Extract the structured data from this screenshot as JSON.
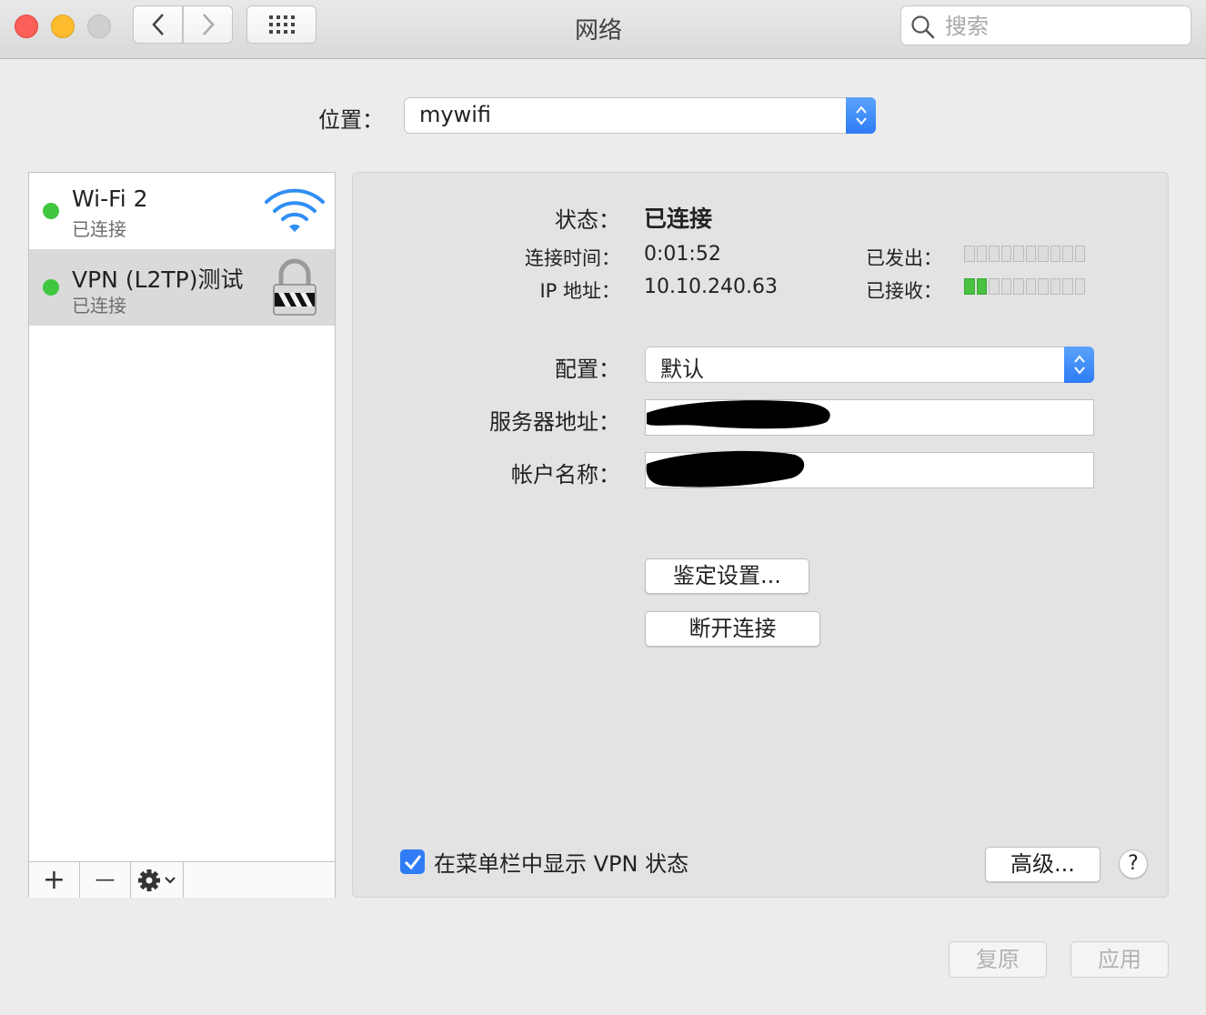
{
  "window": {
    "title": "网络"
  },
  "search": {
    "placeholder": "搜索"
  },
  "location": {
    "label": "位置：",
    "value": "mywifi"
  },
  "services": [
    {
      "name": "Wi-Fi 2",
      "status": "已连接",
      "icon": "wifi-icon",
      "status_color": "#3fc740"
    },
    {
      "name": "VPN (L2TP)测试",
      "status": "已连接",
      "icon": "vpn-lock-icon",
      "status_color": "#3fc740"
    }
  ],
  "sidebar_toolbar": {
    "add": "+",
    "remove": "—",
    "action_icon": "gear-icon"
  },
  "status": {
    "label": "状态：",
    "value": "已连接",
    "connect_time_label": "连接时间：",
    "connect_time": "0:01:52",
    "ip_label": "IP 地址：",
    "ip": "10.10.240.63",
    "sent_label": "已发出：",
    "received_label": "已接收：",
    "sent_level": 0,
    "received_level": 2,
    "meter_segments": 10
  },
  "config": {
    "label": "配置：",
    "value": "默认",
    "server_label": "服务器地址：",
    "account_label": "帐户名称："
  },
  "buttons": {
    "auth": "鉴定设置...",
    "disconnect": "断开连接",
    "advanced": "高级...",
    "help": "?",
    "revert": "复原",
    "apply": "应用"
  },
  "menubar_checkbox": {
    "label": "在菜单栏中显示 VPN 状态",
    "checked": true
  },
  "colors": {
    "accent": "#2f7cf6",
    "status_green": "#3fc740"
  }
}
